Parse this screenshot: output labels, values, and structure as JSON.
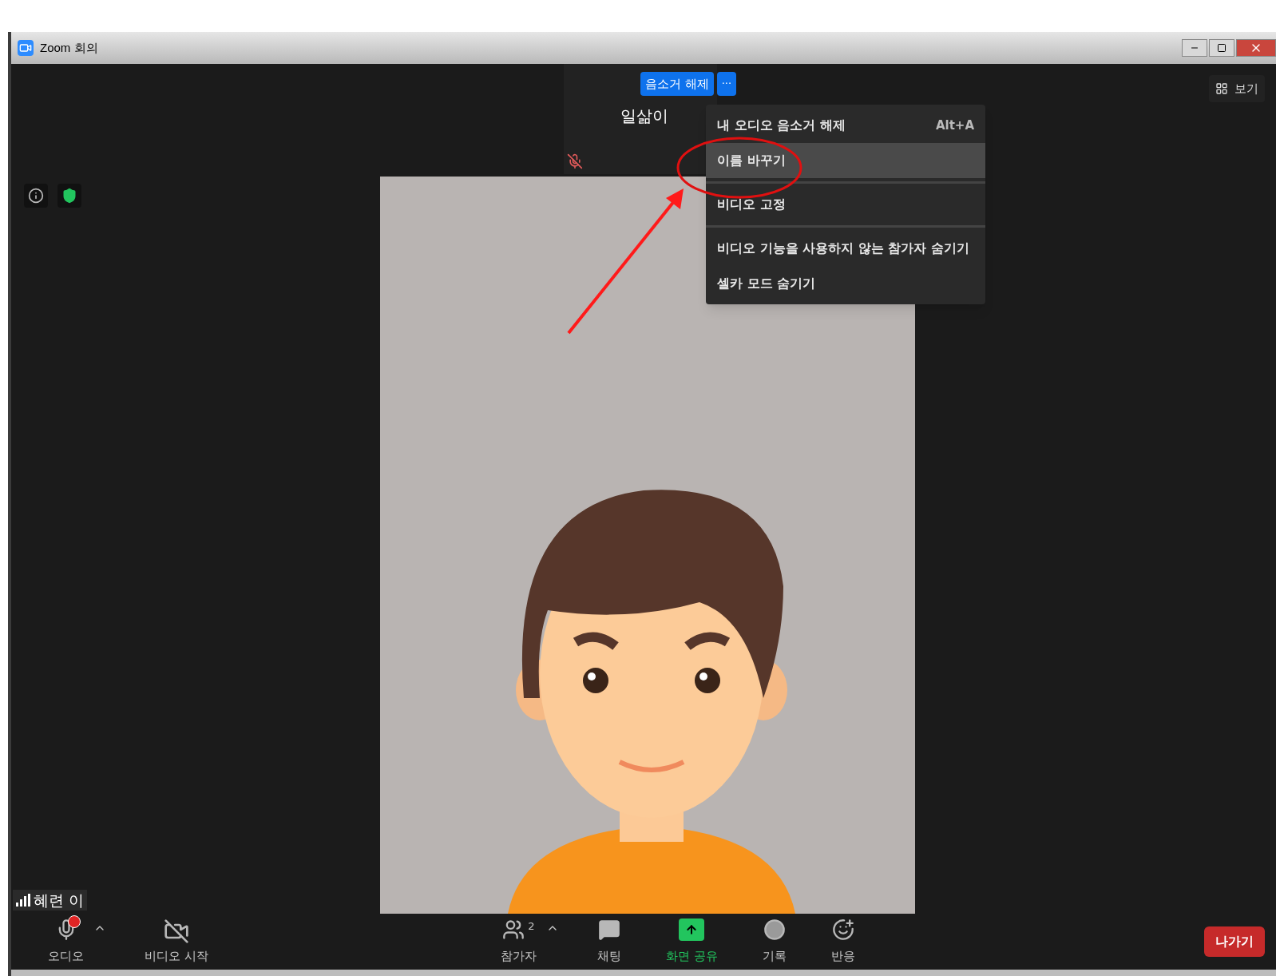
{
  "window": {
    "title": "Zoom 회의"
  },
  "self_view": {
    "unmute_button": "음소거 해제",
    "more_button": "···",
    "name": "일삶이",
    "muted": true
  },
  "context_menu": {
    "items": [
      {
        "label": "내 오디오 음소거 해제",
        "shortcut": "Alt+A",
        "selected": false,
        "divider_after": false
      },
      {
        "label": "이름 바꾸기",
        "selected": true,
        "divider_after": true
      },
      {
        "label": "비디오 고정",
        "selected": false,
        "divider_after": true
      },
      {
        "label": "비디오 기능을 사용하지 않는 참가자 숨기기",
        "selected": false,
        "divider_after": false
      },
      {
        "label": "셀카 모드 숨기기",
        "selected": false,
        "divider_after": false
      }
    ]
  },
  "view_button": "보기",
  "video": {
    "name_tag": "혜련 이"
  },
  "toolbar": {
    "left": [
      {
        "kind": "audio",
        "label": "오디오",
        "alert": true,
        "caret": true,
        "active": false
      },
      {
        "kind": "video",
        "label": "비디오 시작",
        "alert": false,
        "caret": false,
        "active": false
      }
    ],
    "center": [
      {
        "kind": "participants",
        "label": "참가자",
        "count": "2",
        "alert": false,
        "caret": true,
        "active": false
      },
      {
        "kind": "chat",
        "label": "채팅",
        "alert": false,
        "caret": false,
        "active": false
      },
      {
        "kind": "share",
        "label": "화면 공유",
        "alert": false,
        "caret": false,
        "active": true
      },
      {
        "kind": "record",
        "label": "기록",
        "alert": false,
        "caret": false,
        "active": false
      },
      {
        "kind": "reactions",
        "label": "반응",
        "alert": false,
        "caret": false,
        "active": false
      }
    ],
    "leave_button": "나가기"
  }
}
